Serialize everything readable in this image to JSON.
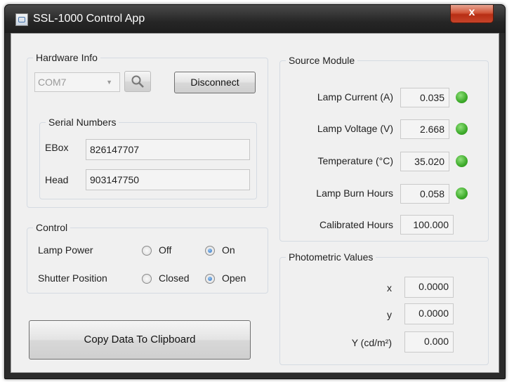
{
  "window": {
    "title": "SSL-1000 Control App",
    "close_label": "x"
  },
  "hardware": {
    "legend": "Hardware Info",
    "port_value": "COM7",
    "disconnect_label": "Disconnect",
    "serial": {
      "legend": "Serial Numbers",
      "ebox_label": "EBox",
      "ebox_value": "826147707",
      "head_label": "Head",
      "head_value": "903147750"
    }
  },
  "control": {
    "legend": "Control",
    "lamp_power_label": "Lamp Power",
    "lamp_off": "Off",
    "lamp_on": "On",
    "shutter_label": "Shutter Position",
    "shutter_closed": "Closed",
    "shutter_open": "Open",
    "lamp_power_selected": "On",
    "shutter_selected": "Open"
  },
  "copy_button_label": "Copy Data To Clipboard",
  "source": {
    "legend": "Source Module",
    "rows": [
      {
        "label": "Lamp Current (A)",
        "value": "0.035",
        "status": "green"
      },
      {
        "label": "Lamp Voltage (V)",
        "value": "2.668",
        "status": "green"
      },
      {
        "label": "Temperature (°C)",
        "value": "35.020",
        "status": "green"
      },
      {
        "label": "Lamp Burn Hours",
        "value": "0.058",
        "status": "green"
      },
      {
        "label": "Calibrated Hours",
        "value": "100.000"
      }
    ]
  },
  "photometric": {
    "legend": "Photometric Values",
    "rows": [
      {
        "label": "x",
        "value": "0.0000"
      },
      {
        "label": "y",
        "value": "0.0000"
      },
      {
        "label": "Y (cd/m²)",
        "value": "0.000"
      }
    ]
  },
  "colors": {
    "status_ok": "#3daa2a",
    "close_button": "#c7442a"
  }
}
